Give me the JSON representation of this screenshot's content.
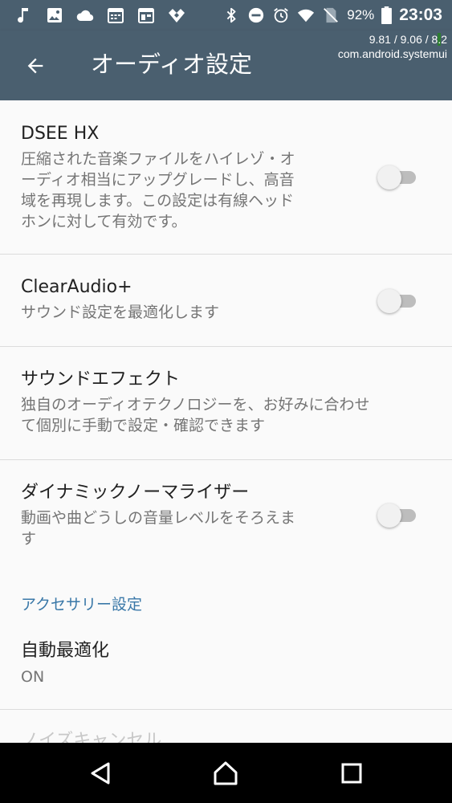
{
  "status_bar": {
    "icons_left": [
      "music-note-icon",
      "image-icon",
      "cloud-icon",
      "calendar-icon",
      "calendar-icon",
      "app-logo-icon"
    ],
    "icons_right": [
      "bluetooth-icon",
      "do-not-disturb-icon",
      "alarm-icon",
      "wifi-icon",
      "no-sim-icon",
      "battery-icon"
    ],
    "battery_percent": "92%",
    "time": "23:03"
  },
  "debug_overlay": {
    "line1_prefix": "9.81 / 9.06 / 8",
    "line1_highlight": ".",
    "line1_suffix": "2",
    "line2": "com.android.systemui"
  },
  "app_bar": {
    "title": "オーディオ設定",
    "back_icon": "arrow-back-icon",
    "color": "#4a5f6f"
  },
  "preferences": {
    "dsee": {
      "title": "DSEE HX",
      "summary_lines": [
        "圧縮された音楽ファイルをハイレゾ・オ",
        "ーディオ相当にアップグレードし、高音",
        "域を再現します。この設定は有線ヘッド",
        "ホンに対して有効です。"
      ],
      "enabled": false
    },
    "clearaudio": {
      "title": "ClearAudio+",
      "summary": "サウンド設定を最適化します",
      "enabled": false
    },
    "sound_effect": {
      "title": "サウンドエフェクト",
      "summary_lines": [
        "独自のオーディオテクノロジーを、お好みに合わせ",
        "て個別に手動で設定・確認できます"
      ]
    },
    "dynamic_normalizer": {
      "title": "ダイナミックノーマライザー",
      "summary_lines": [
        "動画や曲どうしの音量レベルをそろえま",
        "す"
      ],
      "enabled": false
    }
  },
  "accessory_section": {
    "header": "アクセサリー設定",
    "header_color": "#3a78a8",
    "auto_optimize": {
      "title": "自動最適化",
      "value": "ON"
    },
    "noise_cancel_partial": "ノイズキャンセル"
  },
  "nav_bar": {
    "back": "nav-back-icon",
    "home": "nav-home-icon",
    "recents": "nav-recents-icon"
  }
}
